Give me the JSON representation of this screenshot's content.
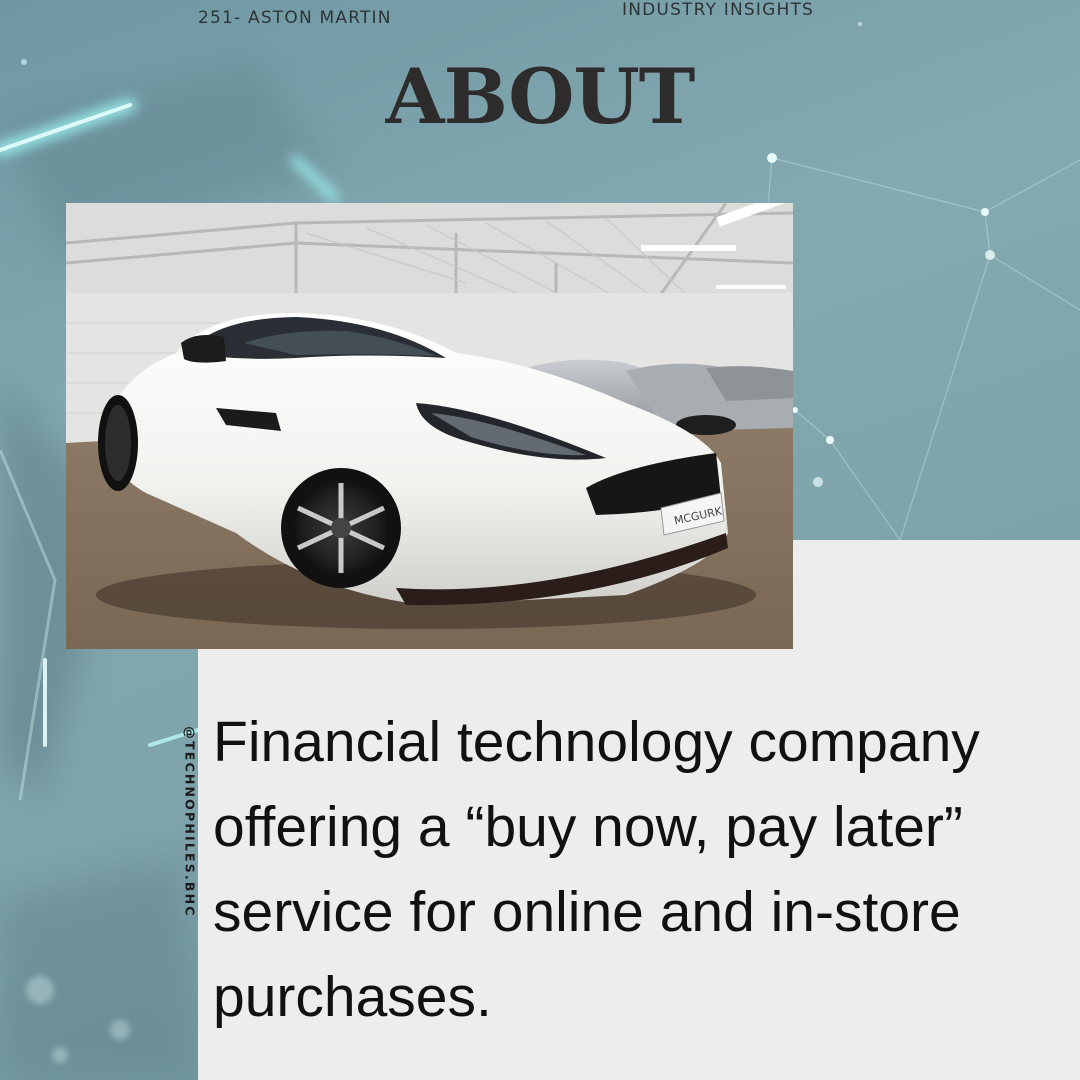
{
  "header": {
    "series_label": "251- ASTON MARTIN",
    "category_label": "INDUSTRY INSIGHTS",
    "title": "ABOUT"
  },
  "sidebar": {
    "handle": "@TECHNOPHILES.BHC"
  },
  "content": {
    "description": "Financial technology company offering a “buy now, pay later” service for online and in-store purchases."
  },
  "photo": {
    "subject": "white Aston Martin sports car in showroom",
    "plate_text": "MCGURK"
  },
  "colors": {
    "background": "#7fa3ab",
    "panel": "#ededed",
    "title": "#2d2b2b",
    "glow": "#7ff3f0"
  }
}
